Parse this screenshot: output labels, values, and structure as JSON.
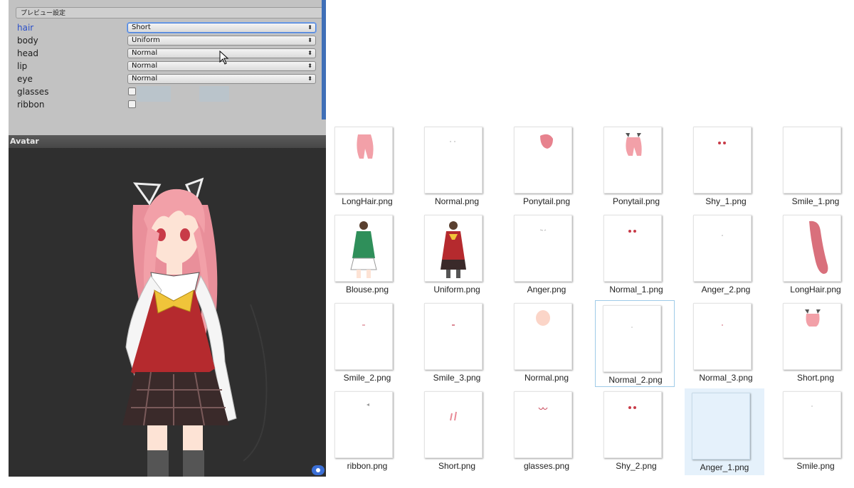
{
  "inspector": {
    "header": "プレビュー設定",
    "properties": [
      {
        "label": "hair",
        "value": "Short"
      },
      {
        "label": "body",
        "value": "Uniform"
      },
      {
        "label": "head",
        "value": "Normal"
      },
      {
        "label": "lip",
        "value": "Normal"
      },
      {
        "label": "eye",
        "value": "Normal"
      }
    ],
    "toggles": [
      {
        "label": "glasses",
        "checked": false
      },
      {
        "label": "ribbon",
        "checked": false
      }
    ],
    "dropdown_arrow": "⬍"
  },
  "avatar": {
    "title": "Avatar"
  },
  "files": [
    "LongHair.png",
    "Normal.png",
    "Ponytail.png",
    "Ponytail.png",
    "Shy_1.png",
    "Smile_1.png",
    "Blouse.png",
    "Uniform.png",
    "Anger.png",
    "Normal_1.png",
    "Anger_2.png",
    "LongHair.png",
    "Smile_2.png",
    "Smile_3.png",
    "Normal.png",
    "Normal_2.png",
    "Normal_3.png",
    "Short.png",
    "ribbon.png",
    "Short.png",
    "glasses.png",
    "Shy_2.png",
    "Anger_1.png",
    "Smile.png"
  ],
  "colors": {
    "accent": "#2a4fc9",
    "selection": "#e5f1fb",
    "hair_pink": "#f2a0a8"
  }
}
